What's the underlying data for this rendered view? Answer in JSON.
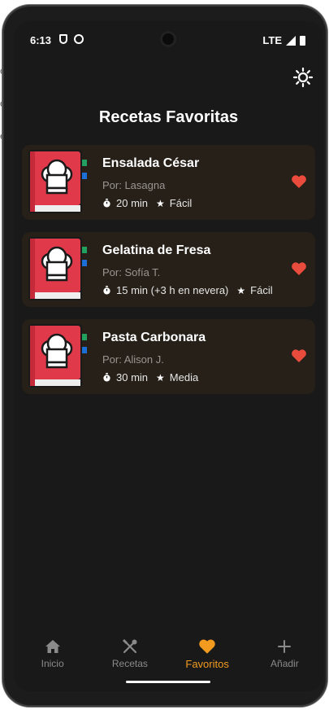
{
  "status_bar": {
    "time": "6:13",
    "network": "LTE"
  },
  "header": {
    "title": "Recetas Favoritas"
  },
  "recipes": [
    {
      "title": "Ensalada César",
      "author": "Por: Lasagna",
      "time": "20 min",
      "difficulty": "Fácil",
      "favorite": true
    },
    {
      "title": "Gelatina de Fresa",
      "author": "Por: Sofía T.",
      "time": "15 min (+3 h en nevera)",
      "difficulty": "Fácil",
      "favorite": true
    },
    {
      "title": "Pasta Carbonara",
      "author": "Por: Alison J.",
      "time": "30 min",
      "difficulty": "Media",
      "favorite": true
    }
  ],
  "nav": {
    "items": [
      {
        "label": "Inicio",
        "icon": "home-icon"
      },
      {
        "label": "Recetas",
        "icon": "utensils-icon"
      },
      {
        "label": "Favoritos",
        "icon": "heart-icon"
      },
      {
        "label": "Añadir",
        "icon": "plus-icon"
      }
    ],
    "active_index": 2
  },
  "colors": {
    "background": "#191919",
    "card": "#262019",
    "accent": "#f39b1f",
    "heart": "#e94b3c",
    "book_red": "#e0394a"
  }
}
